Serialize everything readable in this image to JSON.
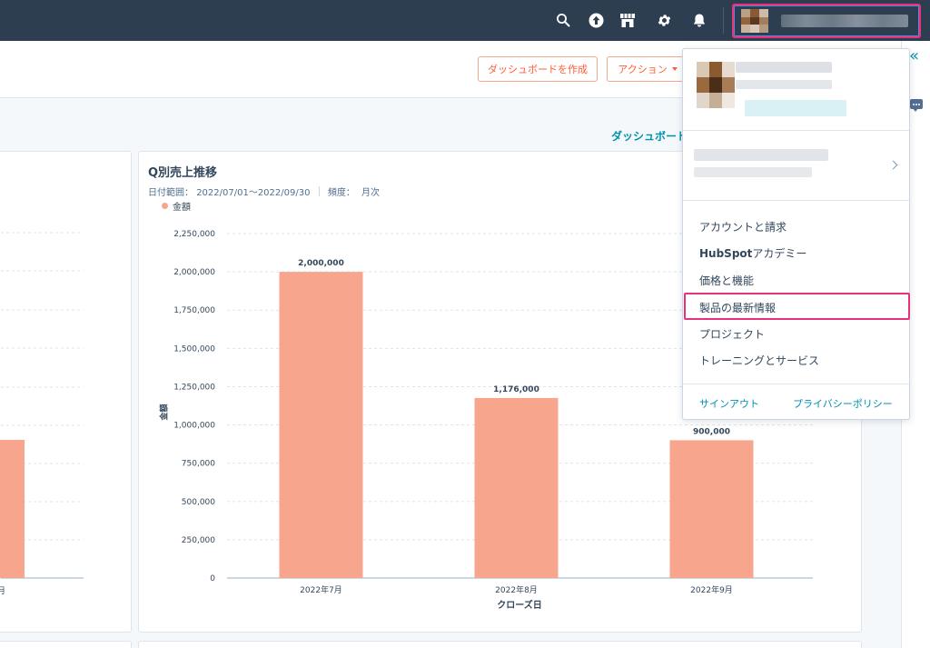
{
  "colors": {
    "nav_bg": "#2d3e50",
    "accent_orange": "#ff5c35",
    "bar_fill": "#f8a58e",
    "link_teal": "#0091ae",
    "highlight_pink": "#e8317c"
  },
  "topnav": {
    "icons": [
      "search-icon",
      "upgrade-arrow-icon",
      "marketplace-icon",
      "gear-icon",
      "bell-icon"
    ]
  },
  "subheader": {
    "create_dashboard_label": "ダッシュボードを作成",
    "actions_label": "アクション"
  },
  "dashboard_link": "ダッシュボード",
  "report": {
    "title": "Q別売上推移",
    "date_range_label": "日付範囲：",
    "date_range_value": "2022/07/01〜2022/09/30",
    "frequency_label": "頻度：",
    "frequency_value": "月次",
    "legend_label": "金額"
  },
  "chart_data": {
    "type": "bar",
    "categories": [
      "2022年7月",
      "2022年8月",
      "2022年9月"
    ],
    "series": [
      {
        "name": "金額",
        "values": [
          2000000,
          1176000,
          900000
        ]
      }
    ],
    "data_labels": [
      "2,000,000",
      "1,176,000",
      "900,000"
    ],
    "xlabel": "クローズ日",
    "ylabel": "金額",
    "ylim": [
      0,
      2250000
    ],
    "yticks": [
      0,
      250000,
      500000,
      750000,
      1000000,
      1250000,
      1500000,
      1750000,
      2000000,
      2250000
    ],
    "ytick_labels": [
      "0",
      "250,000",
      "500,000",
      "750,000",
      "1,000,000",
      "1,250,000",
      "1,500,000",
      "1,750,000",
      "2,000,000",
      "2,250,000"
    ],
    "grid": true,
    "legend_position": "top-left"
  },
  "left_chart_partial": {
    "visible_bar_value": 900000,
    "visible_category_tail": "月"
  },
  "account_menu": {
    "items": [
      {
        "label": "アカウントと請求"
      },
      {
        "label_bold": "HubSpot",
        "label_rest": "アカデミー"
      },
      {
        "label": "価格と機能"
      },
      {
        "label": "製品の最新情報"
      },
      {
        "label": "プロジェクト"
      },
      {
        "label": "トレーニングとサービス"
      }
    ],
    "sign_out": "サインアウト",
    "privacy_policy": "プライバシーポリシー"
  }
}
